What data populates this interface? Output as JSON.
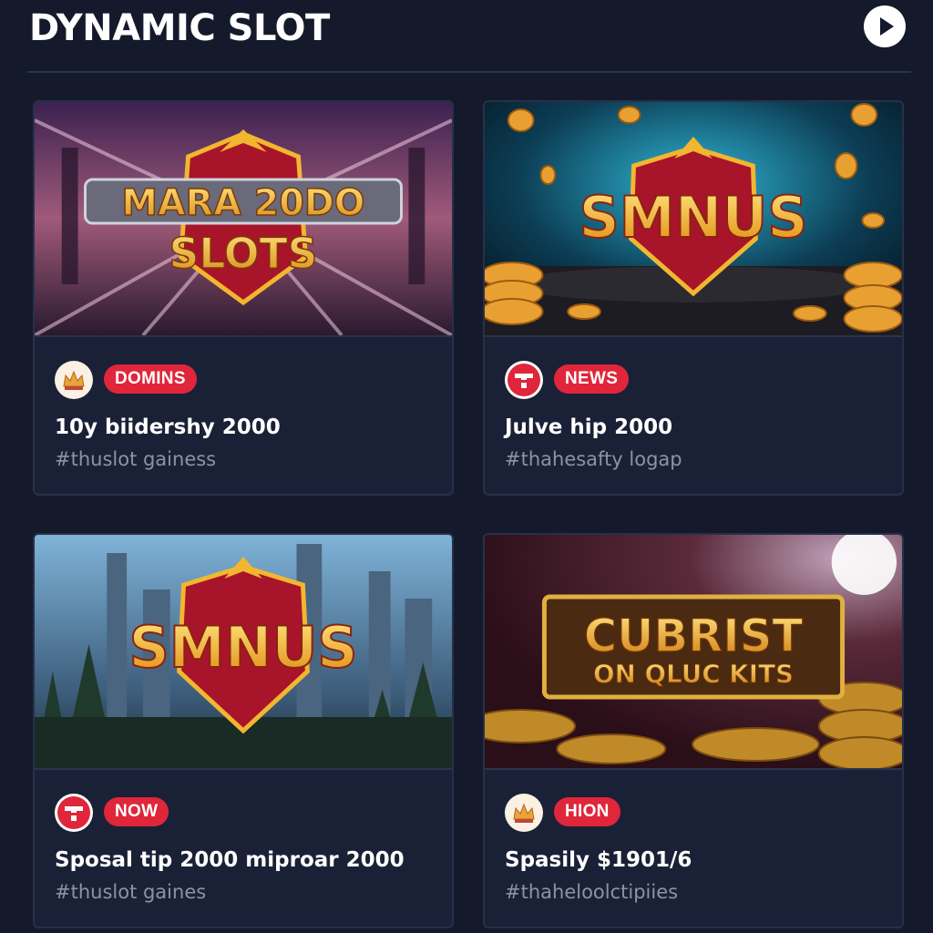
{
  "header": {
    "title": "DYNAMIC SLOT",
    "play_icon": "play-icon"
  },
  "cards": [
    {
      "art_title_line1": "MARA 20DO",
      "art_title_line2": "SLOTS",
      "avatar_icon": "crown-icon",
      "badge": "DOMINS",
      "title": "10y biidershy 2000",
      "tag": "#thuslot gainess"
    },
    {
      "art_title_line1": "SMNUS",
      "avatar_icon": "brand-logo-icon",
      "badge": "NEWS",
      "title": "Julve hip 2000",
      "tag": "#thahesafty logap"
    },
    {
      "art_title_line1": "SMNUS",
      "avatar_icon": "brand-logo-icon",
      "badge": "NOW",
      "title": "Sposal tip 2000 miproar 2000",
      "tag": "#thuslot gaines"
    },
    {
      "art_title_line1": "CUBRIST",
      "art_title_line2": "ON QLUC KITS",
      "avatar_icon": "crown-icon",
      "badge": "HION",
      "title": "Spasily $1901/6",
      "tag": "#thaheloolctipiies"
    }
  ],
  "colors": {
    "background": "#141a2c",
    "card": "#1a2136",
    "badge": "#e0263a",
    "tag_text": "#8a93a8",
    "gold": "#f2b630"
  }
}
